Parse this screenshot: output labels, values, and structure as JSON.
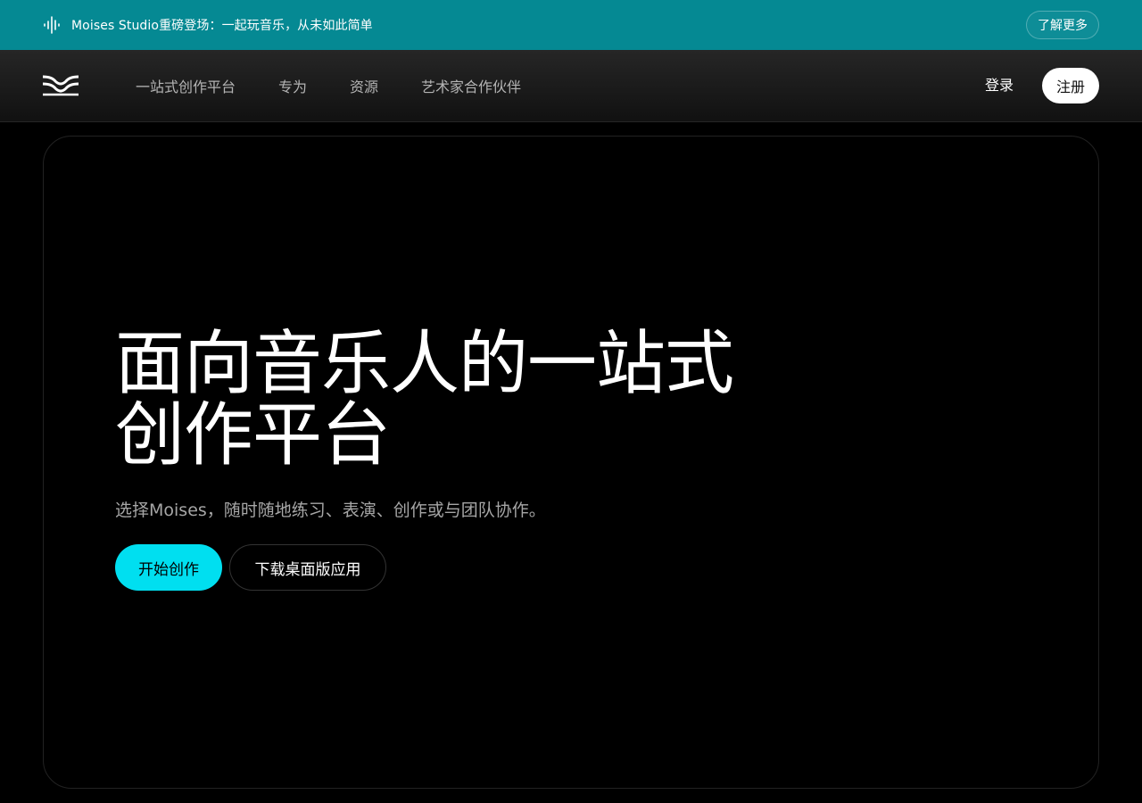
{
  "announcement": {
    "icon": "waveform-icon",
    "text": "Moises Studio重磅登场：一起玩音乐，从未如此简单",
    "button_label": "了解更多"
  },
  "nav": {
    "logo": "moises-logo",
    "links": [
      {
        "label": "一站式创作平台"
      },
      {
        "label": "专为"
      },
      {
        "label": "资源"
      },
      {
        "label": "艺术家合作伙伴"
      }
    ],
    "login_label": "登录",
    "signup_label": "注册"
  },
  "hero": {
    "title_line1": "面向音乐人的一站式",
    "title_line2": "创作平台",
    "subtitle": "选择Moises，随时随地练习、表演、创作或与团队协作。",
    "primary_cta": "开始创作",
    "secondary_cta": "下载桌面版应用"
  },
  "colors": {
    "announcement_bg": "#058993",
    "accent": "#00dff0",
    "page_bg": "#000000"
  }
}
